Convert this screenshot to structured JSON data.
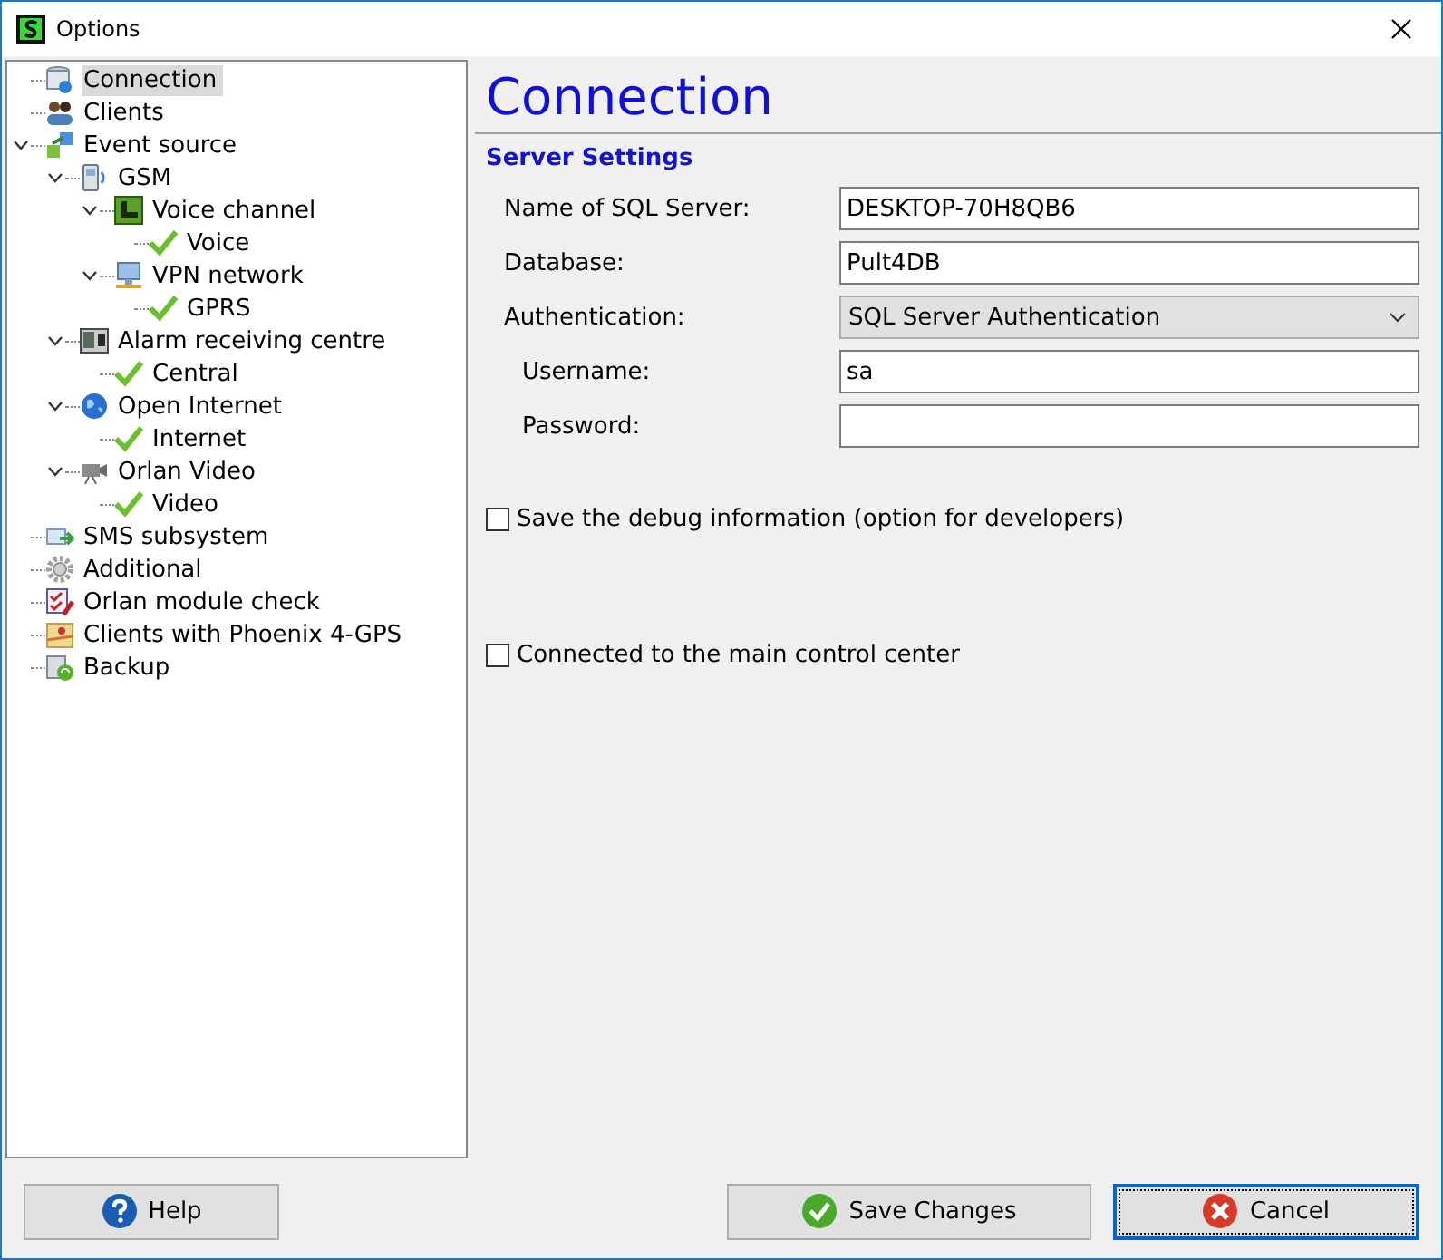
{
  "window": {
    "title": "Options"
  },
  "tree": [
    {
      "label": "Connection",
      "kind": "database",
      "selected": true
    },
    {
      "label": "Clients",
      "kind": "people",
      "selected": false
    },
    {
      "label": "Event source",
      "kind": "transfer",
      "selected": false,
      "expanded": true,
      "children": [
        {
          "label": "GSM",
          "kind": "phone",
          "selected": false,
          "expanded": true,
          "children": [
            {
              "label": "Voice channel",
              "kind": "handset",
              "selected": false,
              "expanded": true,
              "children": [
                {
                  "label": "Voice",
                  "kind": "check",
                  "selected": false
                }
              ]
            },
            {
              "label": "VPN network",
              "kind": "monitor",
              "selected": false,
              "expanded": true,
              "children": [
                {
                  "label": "GPRS",
                  "kind": "check",
                  "selected": false
                }
              ]
            }
          ]
        },
        {
          "label": "Alarm receiving centre",
          "kind": "panel",
          "selected": false,
          "expanded": true,
          "children": [
            {
              "label": "Central",
              "kind": "check",
              "selected": false
            }
          ]
        },
        {
          "label": "Open Internet",
          "kind": "globe",
          "selected": false,
          "expanded": true,
          "children": [
            {
              "label": "Internet",
              "kind": "check",
              "selected": false
            }
          ]
        },
        {
          "label": "Orlan Video",
          "kind": "camera",
          "selected": false,
          "expanded": true,
          "children": [
            {
              "label": "Video",
              "kind": "check",
              "selected": false
            }
          ]
        }
      ]
    },
    {
      "label": "SMS subsystem",
      "kind": "mail",
      "selected": false
    },
    {
      "label": "Additional",
      "kind": "gear",
      "selected": false
    },
    {
      "label": "Orlan module check",
      "kind": "checklist",
      "selected": false
    },
    {
      "label": "Clients with Phoenix 4-GPS",
      "kind": "map",
      "selected": false
    },
    {
      "label": "Backup",
      "kind": "backup",
      "selected": false
    }
  ],
  "page": {
    "title": "Connection",
    "section": "Server Settings",
    "fields": [
      {
        "label": "Name of SQL Server:",
        "kind": "text",
        "value": "DESKTOP-70H8QB6",
        "indented": false
      },
      {
        "label": "Database:",
        "kind": "text",
        "value": "Pult4DB",
        "indented": false
      },
      {
        "label": "Authentication:",
        "kind": "dropdown",
        "value": "SQL Server Authentication",
        "indented": false
      },
      {
        "label": "Username:",
        "kind": "text",
        "value": "sa",
        "indented": true
      },
      {
        "label": "Password:",
        "kind": "password",
        "indented": true
      }
    ],
    "checkboxes": [
      {
        "label": "Save the debug information (option for developers)",
        "checked": false
      },
      {
        "label": "Connected to the main control center",
        "checked": false
      }
    ]
  },
  "buttons": [
    {
      "label": "Help",
      "kind": "help",
      "focused": false
    },
    {
      "label": "Save Changes",
      "kind": "save",
      "focused": false
    },
    {
      "label": "Cancel",
      "kind": "cancel",
      "focused": true
    }
  ]
}
